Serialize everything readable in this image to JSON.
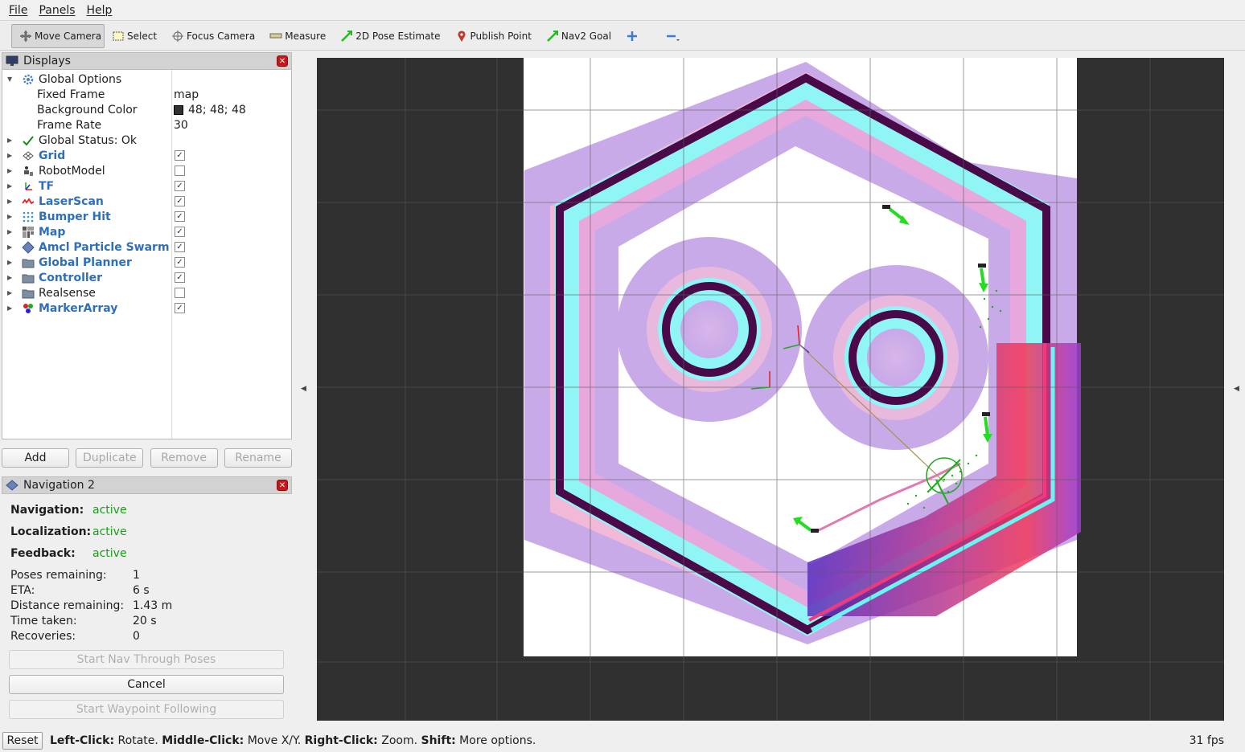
{
  "menubar": {
    "items": [
      "File",
      "Panels",
      "Help"
    ]
  },
  "toolbar": {
    "tools": [
      {
        "label": "Move Camera",
        "icon": "move-camera-icon",
        "active": true
      },
      {
        "label": "Select",
        "icon": "select-icon"
      },
      {
        "label": "Focus Camera",
        "icon": "focus-camera-icon"
      },
      {
        "label": "Measure",
        "icon": "measure-icon"
      },
      {
        "label": "2D Pose Estimate",
        "icon": "pose-estimate-icon"
      },
      {
        "label": "Publish Point",
        "icon": "publish-point-icon"
      },
      {
        "label": "Nav2 Goal",
        "icon": "nav2-goal-icon"
      }
    ],
    "add_icon": "plus-icon",
    "remove_icon": "minus-icon"
  },
  "displays": {
    "title": "Displays",
    "global_options": "Global Options",
    "fixed_frame_label": "Fixed Frame",
    "fixed_frame_value": "map",
    "background_color_label": "Background Color",
    "background_color_value": "48; 48; 48",
    "background_color_swatch": "#303030",
    "frame_rate_label": "Frame Rate",
    "frame_rate_value": "30",
    "global_status": "Global Status: Ok",
    "items": [
      {
        "label": "Grid",
        "checked": true,
        "icon": "grid-icon"
      },
      {
        "label": "RobotModel",
        "checked": false,
        "icon": "robot-model-icon"
      },
      {
        "label": "TF",
        "checked": true,
        "icon": "tf-icon"
      },
      {
        "label": "LaserScan",
        "checked": true,
        "icon": "laser-scan-icon"
      },
      {
        "label": "Bumper Hit",
        "checked": true,
        "icon": "bumper-hit-icon"
      },
      {
        "label": "Map",
        "checked": true,
        "icon": "map-icon"
      },
      {
        "label": "Amcl Particle Swarm",
        "checked": true,
        "icon": "particle-swarm-icon"
      },
      {
        "label": "Global Planner",
        "checked": true,
        "icon": "folder-icon"
      },
      {
        "label": "Controller",
        "checked": true,
        "icon": "folder-icon"
      },
      {
        "label": "Realsense",
        "checked": false,
        "icon": "folder-icon"
      },
      {
        "label": "MarkerArray",
        "checked": true,
        "icon": "marker-array-icon"
      }
    ],
    "buttons": [
      "Add",
      "Duplicate",
      "Remove",
      "Rename"
    ]
  },
  "navigation": {
    "title": "Navigation 2",
    "navigation_label": "Navigation:",
    "navigation_value": "active",
    "localization_label": "Localization:",
    "localization_value": "active",
    "feedback_label": "Feedback:",
    "feedback_value": "active",
    "poses_remaining_label": "Poses remaining:",
    "poses_remaining_value": "1",
    "eta_label": "ETA:",
    "eta_value": "6 s",
    "distance_label": "Distance remaining:",
    "distance_value": "1.43 m",
    "time_label": "Time taken:",
    "time_value": "20 s",
    "recoveries_label": "Recoveries:",
    "recoveries_value": "0",
    "start_nav_button": "Start Nav Through Poses",
    "cancel_button": "Cancel",
    "start_waypoint_button": "Start Waypoint Following"
  },
  "status": {
    "reset": "Reset",
    "hint_left_key": "Left-Click:",
    "hint_left": " Rotate. ",
    "hint_middle_key": "Middle-Click:",
    "hint_middle": " Move X/Y. ",
    "hint_right_key": "Right-Click:",
    "hint_right": " Zoom. ",
    "hint_shift_key": "Shift:",
    "hint_shift": " More options.",
    "fps": "31 fps"
  },
  "colors": {
    "viewport_bg": "#303030",
    "wall": "#4a0a4a",
    "inflation_cyan": "#8ff5f5",
    "inflation_purple": "#c9a8e8",
    "costmap_gradient_red": "#e8204e",
    "path": "#e07ab0",
    "goal_arrows": "#22dd22",
    "active_text": "#16a016",
    "link_blue": "#2f6fba"
  }
}
